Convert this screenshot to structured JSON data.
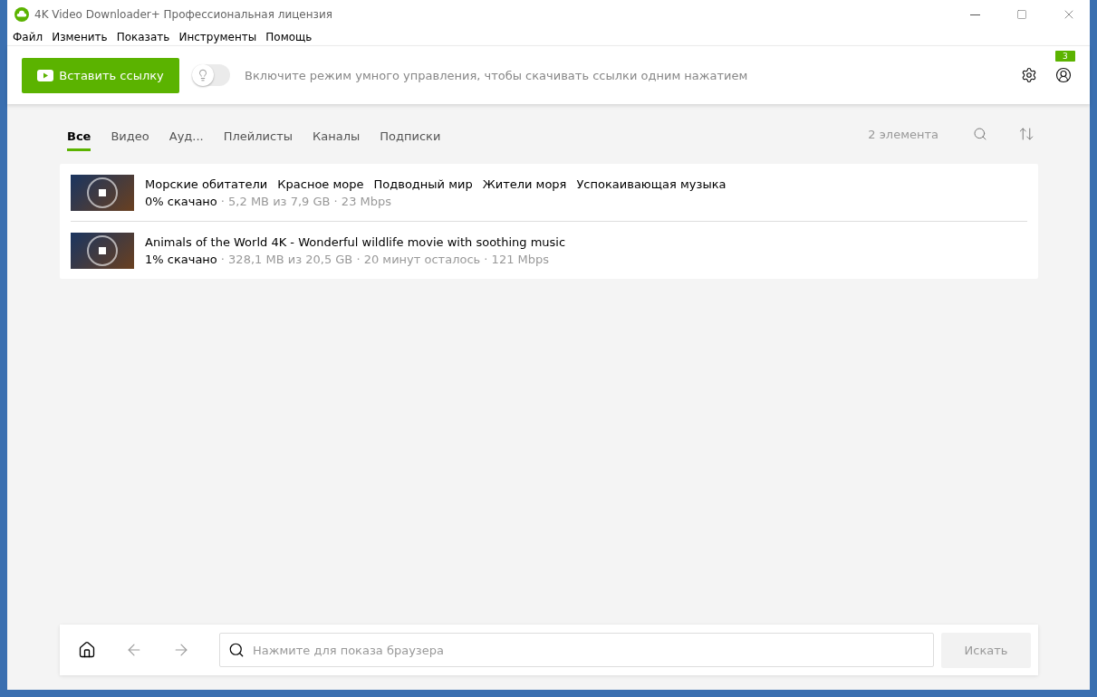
{
  "window": {
    "title": "4K Video Downloader+ Профессиональная лицензия"
  },
  "menu": [
    "Файл",
    "Изменить",
    "Показать",
    "Инструменты",
    "Помощь"
  ],
  "toolbar": {
    "paste_button": "Вставить ссылку",
    "smart_mode": {
      "on": false,
      "text": "Включите режим умного управления, чтобы скачивать ссылки одним нажатием"
    },
    "account_badge": "3"
  },
  "tabs": [
    {
      "label": "Все",
      "selected": true
    },
    {
      "label": "Видео",
      "selected": false
    },
    {
      "label": "Ауд...",
      "selected": false
    },
    {
      "label": "Плейлисты",
      "selected": false
    },
    {
      "label": "Каналы",
      "selected": false
    },
    {
      "label": "Подписки",
      "selected": false
    }
  ],
  "item_count": "2 элемента",
  "downloads": [
    {
      "title_parts": [
        "Морские обитатели",
        "Красное море",
        "Подводный мир",
        "Жители моря",
        "Успокаивающая музыка"
      ],
      "progress": "0% скачано",
      "details": "· 5,2 MB из 7,9 GB · 23 Mbps"
    },
    {
      "title_parts": [
        "Animals of the World 4K - Wonderful wildlife movie with soothing music"
      ],
      "progress": "1% скачано",
      "details": "· 328,1 MB из 20,5 GB · 20 минут осталось · 121 Mbps"
    }
  ],
  "browser_bar": {
    "placeholder": "Нажмите для показа браузера",
    "search_button": "Искать",
    "back_disabled": true,
    "forward_disabled": true
  }
}
